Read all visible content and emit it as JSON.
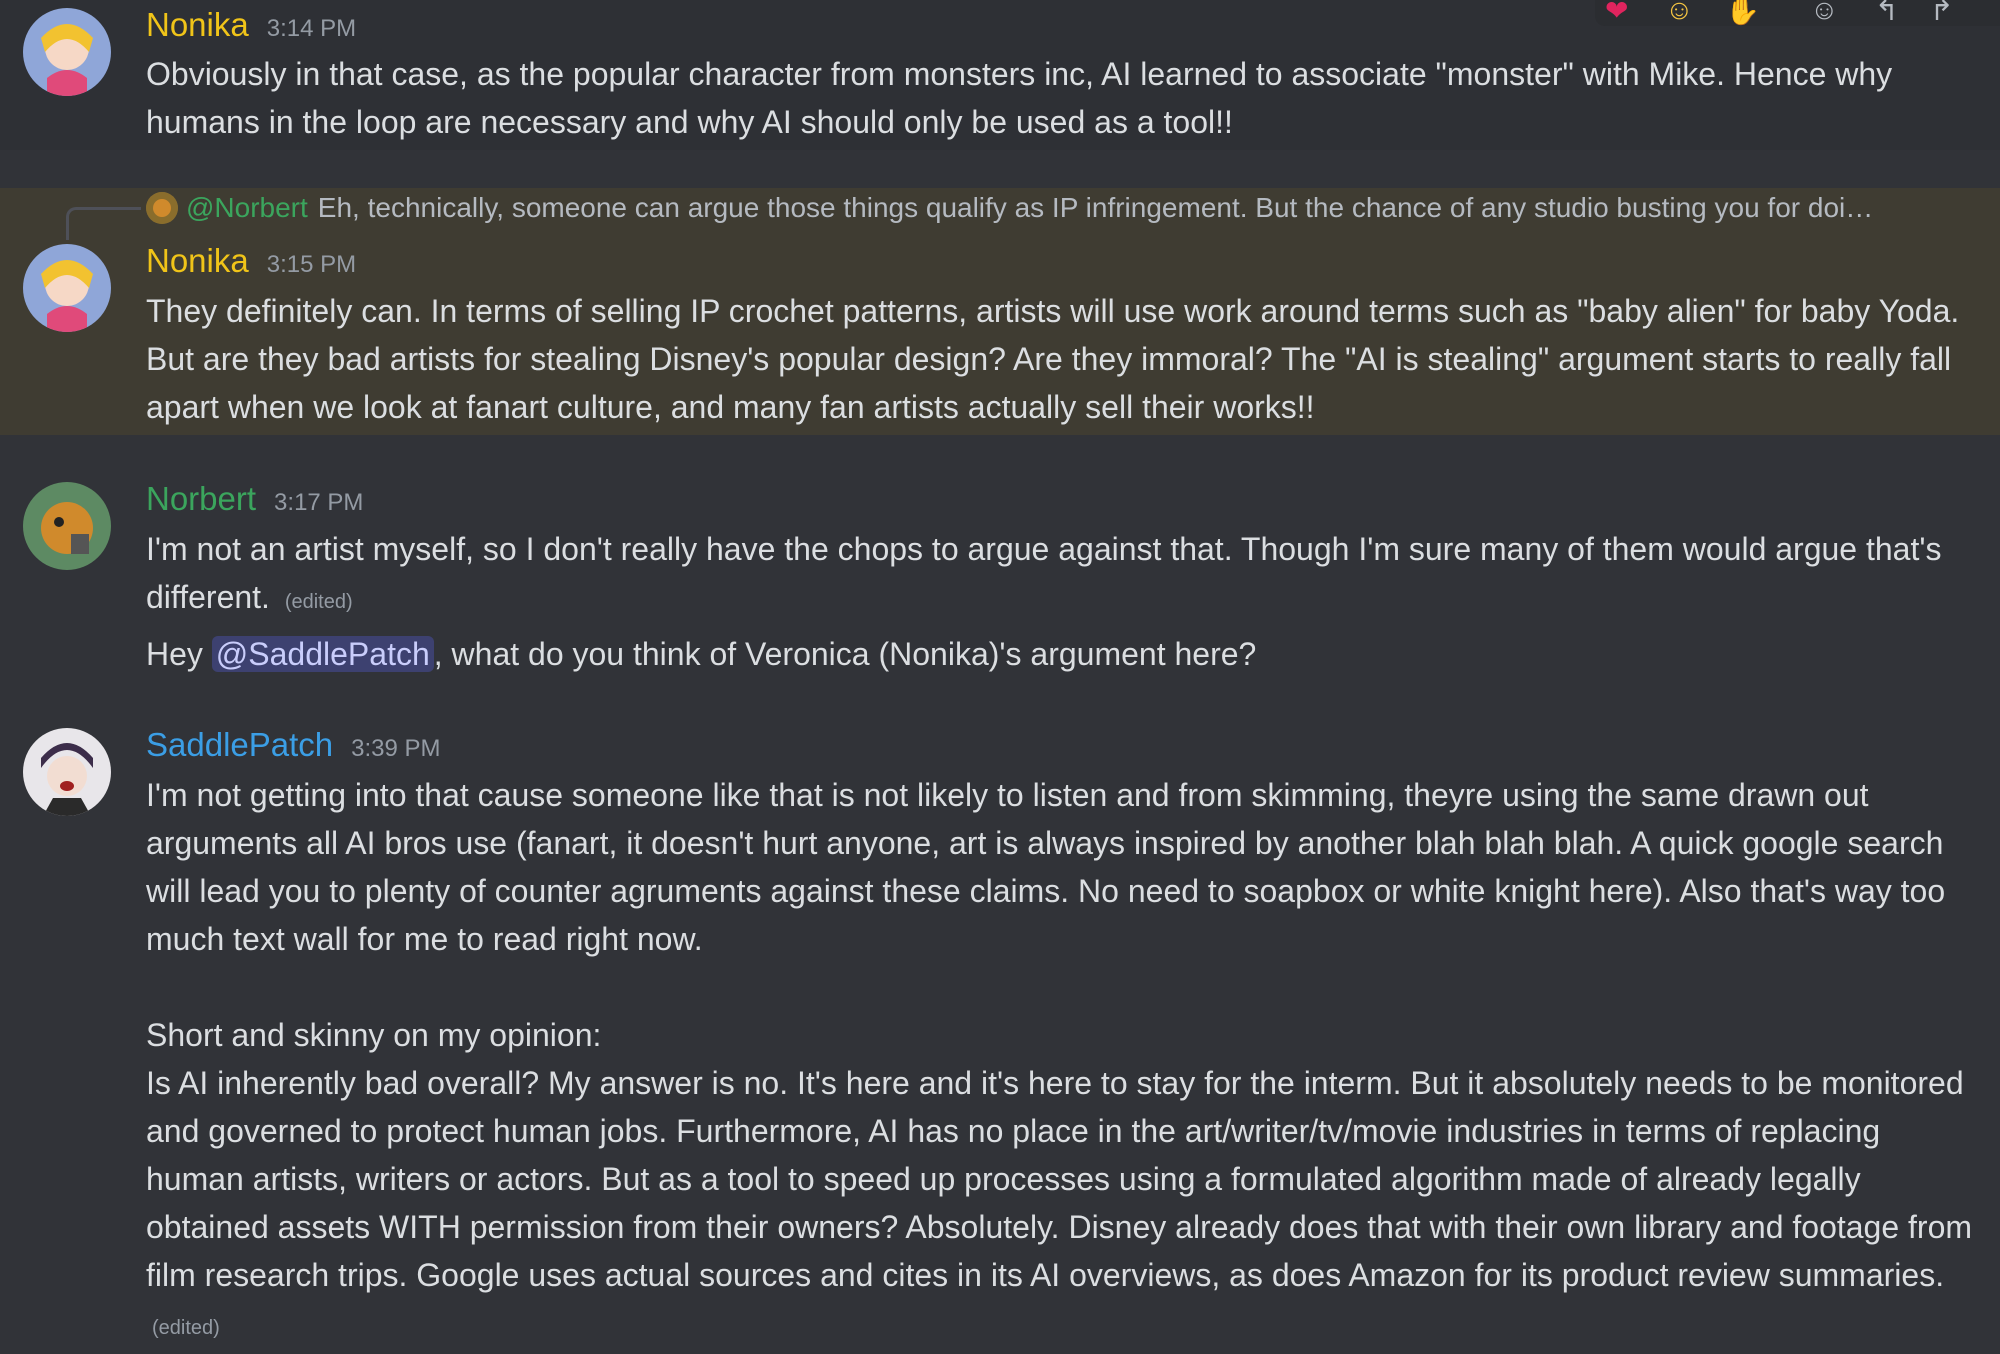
{
  "messages": [
    {
      "author": "Nonika",
      "author_color": "#f0c419",
      "time": "3:14 PM",
      "lines": [
        "Obviously in that case, as the popular character from monsters inc, AI learned to associate \"monster\" with Mike. Hence why humans in the loop are necessary and why AI should only be used as a tool!!"
      ]
    },
    {
      "reply": {
        "author": "@Norbert",
        "text": "Eh, technically, someone can argue those things qualify as IP infringement. But the chance of any studio busting you for doing ..."
      },
      "author": "Nonika",
      "author_color": "#f0c419",
      "time": "3:15 PM",
      "text": "They definitely can. In terms of selling IP crochet patterns, artists will use work around terms such as \"baby alien\" for baby Yoda. But are they bad artists for stealing Disney's popular design? Are they immoral? The \"AI is stealing\" argument starts to really fall apart when we look at fanart culture, and many fan artists actually sell their works!!"
    },
    {
      "author": "Norbert",
      "author_color": "#3ba55d",
      "time": "3:17 PM",
      "text": "I'm not an artist myself, so I don't really have the chops to argue against that. Though I'm sure many of them would argue that's different.",
      "edited": "(edited)",
      "followup_pre": "Hey ",
      "followup_mention": "@SaddlePatch",
      "followup_post": ", what do you think of Veronica (Nonika)'s argument here?"
    },
    {
      "author": "SaddlePatch",
      "author_color": "#3b9ee5",
      "time": "3:39 PM",
      "para1": "I'm not getting into that cause someone like that is not likely to listen and from skimming, theyre using the same drawn out arguments all AI bros use (fanart, it doesn't hurt anyone, art is always inspired by another blah blah blah. A quick google search will lead you to plenty of counter agruments against these claims. No need to soapbox or white knight here). Also that's way too much text wall for me to read right now.",
      "para2": "Short and skinny on my opinion:",
      "para3": "Is AI inherently bad overall? My answer is no. It's here and it's here to stay for the interm. But it absolutely needs to be monitored and governed to protect human jobs. Furthermore, AI has no place in the art/writer/tv/movie industries in terms of replacing human artists, writers or actors. But as a tool to speed up processes using a formulated algorithm made of already legally obtained assets WITH permission from their owners? Absolutely. Disney already does that with their own library and footage from film research trips. Google uses actual sources and cites in its AI overviews, as does Amazon for its product review summaries.",
      "edited": "(edited)"
    }
  ],
  "reactions": [
    "heart",
    "laughing",
    "thumbs-up"
  ]
}
